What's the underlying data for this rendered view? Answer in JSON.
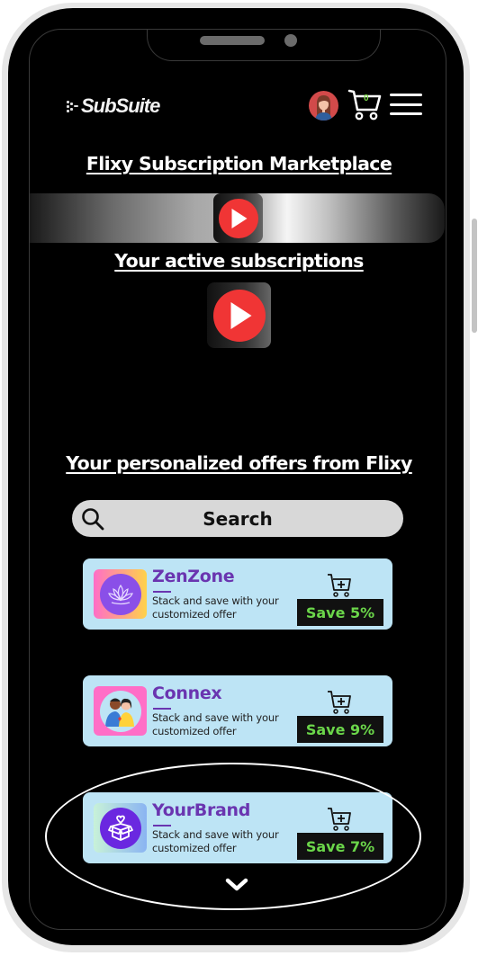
{
  "header": {
    "logo_text": "SubSuite",
    "cart_count": "0",
    "icons": [
      "avatar",
      "cart-icon",
      "hamburger-menu-icon"
    ]
  },
  "marketplace": {
    "title": "Flixy Subscription Marketplace",
    "carousel_icon": "play-icon"
  },
  "active": {
    "title": "Your active subscriptions",
    "items": [
      {
        "icon": "play-icon"
      }
    ]
  },
  "offers": {
    "title": "Your personalized offers from Flixy",
    "search_placeholder": "Search",
    "items": [
      {
        "name": "ZenZone",
        "description": "Stack and save with your customized offer",
        "save_label": "Save 5%",
        "icon": "lotus-icon"
      },
      {
        "name": "Connex",
        "description": "Stack and save with your customized offer",
        "save_label": "Save 9%",
        "icon": "couple-icon"
      },
      {
        "name": "YourBrand",
        "description": "Stack and save with your customized offer",
        "save_label": "Save 7%",
        "icon": "gift-box-icon"
      }
    ],
    "scroll_icon": "chevron-down-icon"
  },
  "colors": {
    "brand_purple": "#6a35b0",
    "card_bg": "#bde4f5",
    "save_green": "#6bd64a",
    "play_red": "#f03535"
  }
}
